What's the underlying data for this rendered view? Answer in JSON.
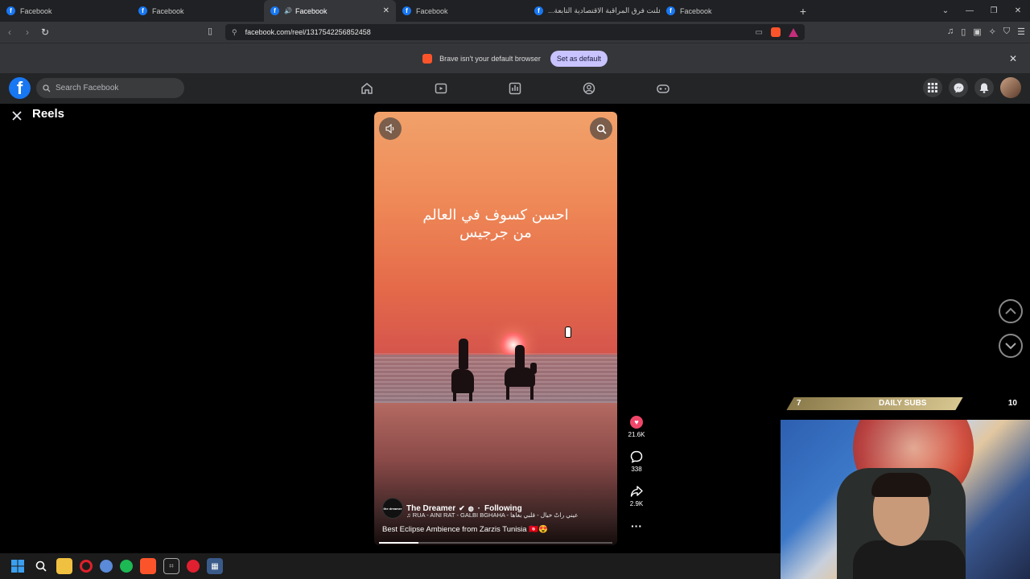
{
  "browser": {
    "tabs": [
      {
        "title": "Facebook",
        "active": false
      },
      {
        "title": "Facebook",
        "active": false
      },
      {
        "title": "Facebook",
        "active": true,
        "audio": true
      },
      {
        "title": "Facebook",
        "active": false
      },
      {
        "title": "أعلنت فرق المراقبة الاقتصادية التابعة...",
        "active": false
      },
      {
        "title": "Facebook",
        "active": false
      }
    ],
    "new_tab": "+",
    "url": "facebook.com/reel/1317542256852458"
  },
  "infobar": {
    "message": "Brave isn't your default browser",
    "button": "Set as default"
  },
  "facebook": {
    "search_placeholder": "Search Facebook"
  },
  "reels": {
    "title": "Reels",
    "video": {
      "caption_line1": "احسن كسوف في العالم",
      "caption_line2": "من جرجيس",
      "author": "The Dreamer",
      "follow_label": "Following",
      "logo_text": "the dreamer",
      "music": "RUA - AINI RAT - GALBI BGHAHA - عيني راتْ خيال - قلبي بغاها",
      "description": "Best Eclipse Ambience from Zarzis Tunisia 🇹🇳😍",
      "progress": 0.17
    },
    "actions": {
      "likes": "21.6K",
      "comments": "338",
      "shares": "2.9K"
    }
  },
  "stream_overlay": {
    "subs_current": "7",
    "subs_label": "DAILY SUBS",
    "subs_goal": "10"
  },
  "colors": {
    "facebook_blue": "#1877f2",
    "brave_orange": "#fb542b",
    "set_default_bg": "#c9c3ff",
    "like_red": "#f0466a"
  }
}
